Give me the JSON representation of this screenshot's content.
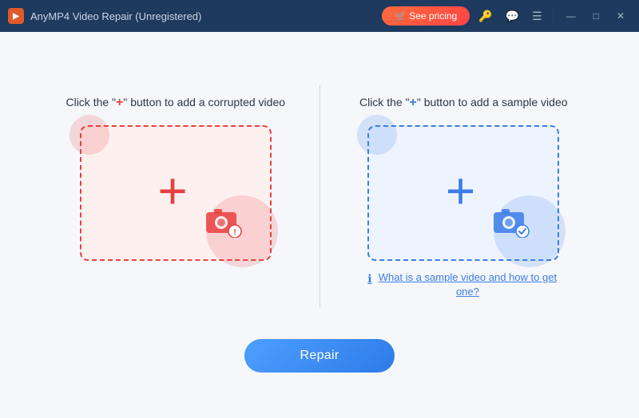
{
  "titleBar": {
    "appIcon": "▶",
    "title": "AnyMP4 Video Repair (Unregistered)",
    "seePricingLabel": "🛒 See pricing",
    "icons": {
      "key": "🔑",
      "chat": "💬",
      "menu": "☰"
    },
    "windowControls": {
      "minimize": "—",
      "maximize": "□",
      "close": "✕"
    }
  },
  "leftPanel": {
    "instruction": "Click the \"+\" button to add a corrupted video",
    "plusChar": "+",
    "colorClass": "red"
  },
  "rightPanel": {
    "instruction": "Click the \"+\" button to add a sample video",
    "plusChar": "+",
    "colorClass": "blue",
    "helpLinkText": "What is a sample video and how to get one?"
  },
  "repairButton": {
    "label": "Repair"
  },
  "colors": {
    "red": "#e84040",
    "blue": "#3b7de8",
    "accent": "#2e7be8"
  }
}
